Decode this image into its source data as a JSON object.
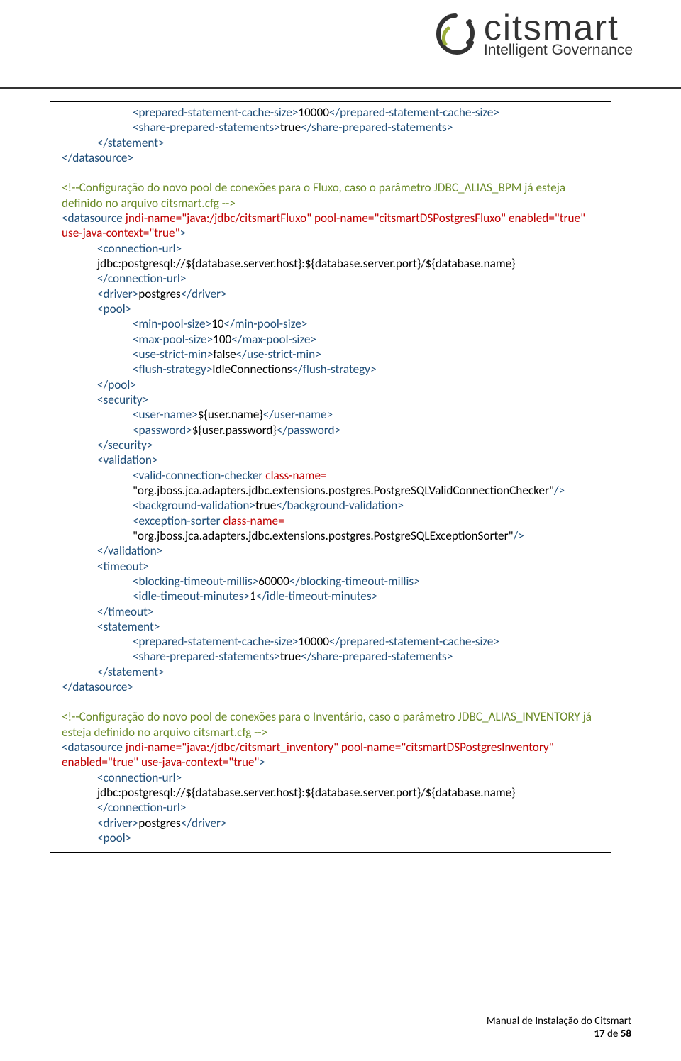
{
  "logo": {
    "name": "citsmart",
    "tagline": "Intelligent Governance"
  },
  "code": {
    "l01": "<prepared-statement-cache-size>",
    "l01v": "10000",
    "l01b": "</prepared-statement-cache-size>",
    "l02": "<share-prepared-statements>",
    "l02v": "true",
    "l02b": "</share-prepared-statements>",
    "l03": "</statement>",
    "l04": "</datasource>",
    "c1a": "<!--Configuração do novo pool de conexões para o Fluxo, caso o parâmetro JDBC_ALIAS_BPM já esteja definido no arquivo citsmart.cfg -->",
    "ds1_open_a": "<datasource ",
    "ds1_jndi": "jndi-name=\"java:/jdbc/citsmartFluxo\" ",
    "ds1_pool": "pool-name=\"citsmartDSPostgresFluxo\" ",
    "ds1_en": "enabled=\"true\" ",
    "ds1_ctx": "use-java-context=\"true\"",
    "ds1_open_b": ">",
    "cu_open": "<connection-url>",
    "cu_val": "jdbc:postgresql://${database.server.host}:${database.server.port}/${database.name}",
    "cu_close": "</connection-url>",
    "drv": "<driver>",
    "drv_v": "postgres",
    "drv_c": "</driver>",
    "pool_o": "<pool>",
    "minps_o": "<min-pool-size>",
    "minps_v": "10",
    "minps_c": "</min-pool-size>",
    "maxps_o": "<max-pool-size>",
    "maxps_v": "100",
    "maxps_c": "</max-pool-size>",
    "usm_o": "<use-strict-min>",
    "usm_v": "false",
    "usm_c": "</use-strict-min>",
    "fs_o": "<flush-strategy>",
    "fs_v": "IdleConnections",
    "fs_c": "</flush-strategy>",
    "pool_c": "</pool>",
    "sec_o": "<security>",
    "un_o": "<user-name>",
    "un_v": "${user.name}",
    "un_c": "</user-name>",
    "pw_o": "<password>",
    "pw_v": "${user.password}",
    "pw_c": "</password>",
    "sec_c": "</security>",
    "val_o": "<validation>",
    "vcc_o": "<valid-connection-checker ",
    "vcc_attr": "class-name=",
    "vcc_val": "\"org.jboss.jca.adapters.jdbc.extensions.postgres.PostgreSQLValidConnectionChecker\"",
    "vcc_c": "/>",
    "bv_o": "<background-validation>",
    "bv_v": "true",
    "bv_c": "</background-validation>",
    "es_o": "<exception-sorter ",
    "es_attr": "class-name=",
    "es_val": "\"org.jboss.jca.adapters.jdbc.extensions.postgres.PostgreSQLExceptionSorter\"",
    "es_c": "/>",
    "val_c": "</validation>",
    "to_o": "<timeout>",
    "btm_o": "<blocking-timeout-millis>",
    "btm_v": "60000",
    "btm_c": "</blocking-timeout-millis>",
    "itm_o": "<idle-timeout-minutes>",
    "itm_v": "1",
    "itm_c": "</idle-timeout-minutes>",
    "to_c": "</timeout>",
    "stmt_o": "<statement>",
    "stmt_c": "</statement>",
    "ds_c": "</datasource>",
    "c2a": "<!--Configuração do novo pool de conexões para o Inventário, caso o parâmetro JDBC_ALIAS_INVENTORY já esteja definido no arquivo citsmart.cfg -->",
    "ds2_jndi": "jndi-name=\"java:/jdbc/citsmart_inventory\" ",
    "ds2_pool": "pool-name=\"citsmartDSPostgresInventory\" "
  },
  "footer": {
    "title": "Manual de Instalação do Citsmart",
    "page_current": "17",
    "page_sep": " de ",
    "page_total": "58"
  }
}
